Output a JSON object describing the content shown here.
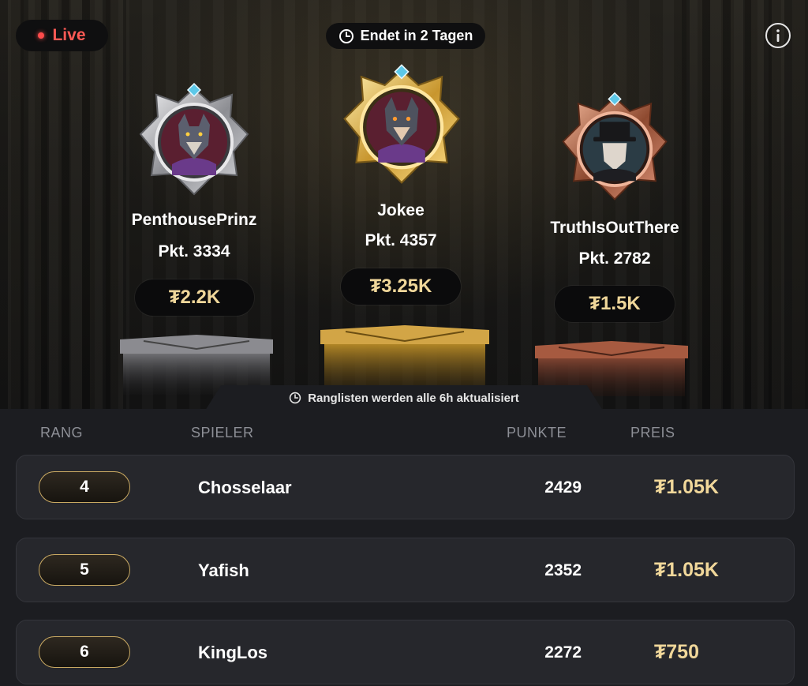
{
  "status": {
    "live_label": "Live"
  },
  "timer": {
    "label": "Endet in 2 Tagen"
  },
  "podium": [
    {
      "place": 2,
      "name": "PenthousePrinz",
      "points": "Pkt. 3334",
      "prize": "₮2.2K",
      "tier": "silver",
      "avatar": "wolf-avatar"
    },
    {
      "place": 1,
      "name": "Jokee",
      "points": "Pkt. 4357",
      "prize": "₮3.25K",
      "tier": "gold",
      "avatar": "wolf-avatar"
    },
    {
      "place": 3,
      "name": "TruthIsOutThere",
      "points": "Pkt. 2782",
      "prize": "₮1.5K",
      "tier": "bronze",
      "avatar": "masked-man-avatar"
    }
  ],
  "update_notice": "Ranglisten werden alle 6h aktualisiert",
  "table": {
    "headers": {
      "rank": "RANG",
      "player": "SPIELER",
      "points": "PUNKTE",
      "prize": "PREIS"
    },
    "rows": [
      {
        "rank": "4",
        "player": "Chosselaar",
        "points": "2429",
        "prize": "₮1.05K"
      },
      {
        "rank": "5",
        "player": "Yafish",
        "points": "2352",
        "prize": "₮1.05K"
      },
      {
        "rank": "6",
        "player": "KingLos",
        "points": "2272",
        "prize": "₮750"
      }
    ]
  },
  "colors": {
    "live_red": "#ff5a55",
    "gold": "#f0d79a",
    "silver": "#b8b8bc",
    "bronze": "#b86a4a"
  }
}
